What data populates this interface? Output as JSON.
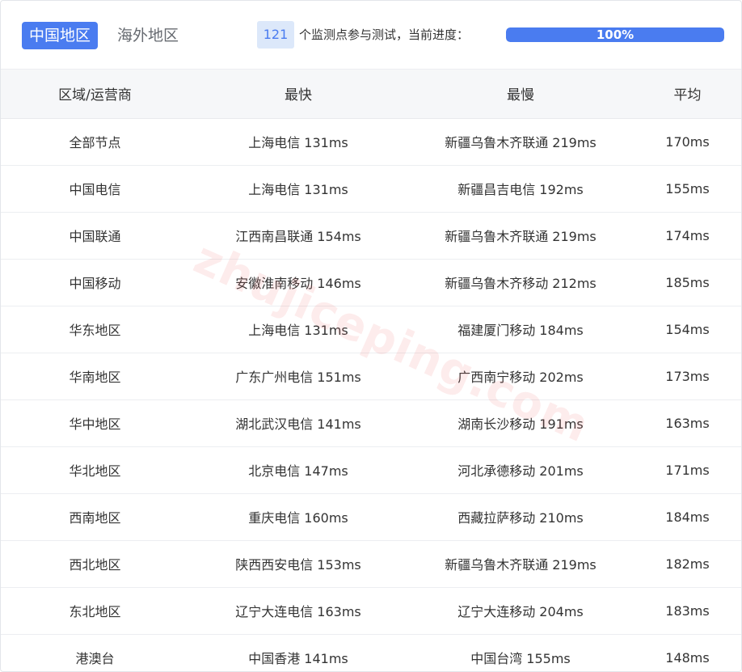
{
  "tabs": {
    "active": "中国地区",
    "inactive": "海外地区"
  },
  "status": {
    "monitor_count": "121",
    "monitor_text": "个监测点参与测试，当前进度：",
    "progress_label": "100%",
    "progress_value": 1.0
  },
  "colors": {
    "accent": "#4a7cf0",
    "badge_bg": "#dce8fa"
  },
  "table": {
    "headers": [
      "区域/运营商",
      "最快",
      "最慢",
      "平均"
    ],
    "rows": [
      [
        "全部节点",
        "上海电信 131ms",
        "新疆乌鲁木齐联通 219ms",
        "170ms"
      ],
      [
        "中国电信",
        "上海电信 131ms",
        "新疆昌吉电信 192ms",
        "155ms"
      ],
      [
        "中国联通",
        "江西南昌联通 154ms",
        "新疆乌鲁木齐联通 219ms",
        "174ms"
      ],
      [
        "中国移动",
        "安徽淮南移动 146ms",
        "新疆乌鲁木齐移动 212ms",
        "185ms"
      ],
      [
        "华东地区",
        "上海电信 131ms",
        "福建厦门移动 184ms",
        "154ms"
      ],
      [
        "华南地区",
        "广东广州电信 151ms",
        "广西南宁移动 202ms",
        "173ms"
      ],
      [
        "华中地区",
        "湖北武汉电信 141ms",
        "湖南长沙移动 191ms",
        "163ms"
      ],
      [
        "华北地区",
        "北京电信 147ms",
        "河北承德移动 201ms",
        "171ms"
      ],
      [
        "西南地区",
        "重庆电信 160ms",
        "西藏拉萨移动 210ms",
        "184ms"
      ],
      [
        "西北地区",
        "陕西西安电信 153ms",
        "新疆乌鲁木齐联通 219ms",
        "182ms"
      ],
      [
        "东北地区",
        "辽宁大连电信 163ms",
        "辽宁大连移动 204ms",
        "183ms"
      ],
      [
        "港澳台",
        "中国香港 141ms",
        "中国台湾 155ms",
        "148ms"
      ]
    ]
  },
  "watermark": "zhujiceping.com"
}
